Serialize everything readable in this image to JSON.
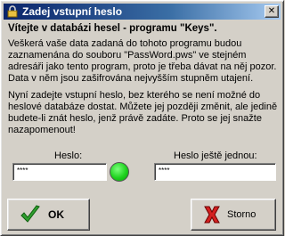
{
  "window": {
    "title": "Zadej vstupní heslo",
    "close_glyph": "✕"
  },
  "heading": "Vítejte v databázi hesel - programu \"Keys\".",
  "paragraph1": "Veškerá vaše data zadaná do tohoto programu budou zaznamenána do souboru \"PassWord.pws\" ve stejném adresáři jako tento program, proto je třeba dávat na něj pozor. Data v něm jsou zašifrována nejvyšším stupněm utajení.",
  "paragraph2": "Nyní zadejte vstupní heslo, bez kterého se není možné do heslové databáze dostat. Můžete jej později změnit, ale jedině budete-li znát heslo, jenž právě zadáte. Proto se jej snažte nazapomenout!",
  "fields": {
    "password": {
      "label": "Heslo:",
      "value": "****"
    },
    "password_confirm": {
      "label": "Heslo ještě jednou:",
      "value": "****"
    }
  },
  "status_light": {
    "color": "#22dd22",
    "icon": "green-status-circle"
  },
  "buttons": {
    "ok": {
      "label": "OK",
      "icon": "checkmark-icon"
    },
    "cancel": {
      "label": "Storno",
      "icon": "x-icon"
    }
  }
}
